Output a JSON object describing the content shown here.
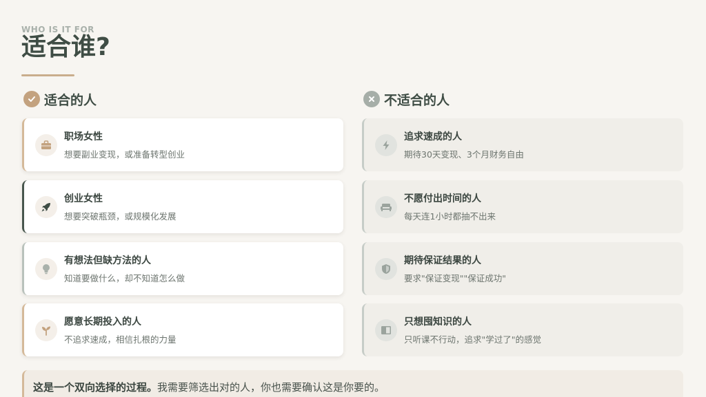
{
  "header": {
    "eyebrow": "WHO IS IT FOR",
    "title": "适合谁?"
  },
  "fit": {
    "heading": "适合的人",
    "items": [
      {
        "icon": "briefcase-icon",
        "title": "职场女性",
        "desc": "想要副业变现，或准备转型创业"
      },
      {
        "icon": "rocket-icon",
        "title": "创业女性",
        "desc": "想要突破瓶颈，或规模化发展"
      },
      {
        "icon": "lightbulb-icon",
        "title": "有想法但缺方法的人",
        "desc": "知道要做什么，却不知道怎么做"
      },
      {
        "icon": "seedling-icon",
        "title": "愿意长期投入的人",
        "desc": "不追求速成，相信扎根的力量"
      }
    ]
  },
  "unfit": {
    "heading": "不适合的人",
    "items": [
      {
        "icon": "bolt-icon",
        "title": "追求速成的人",
        "desc": "期待30天变现、3个月财务自由"
      },
      {
        "icon": "couch-icon",
        "title": "不愿付出时间的人",
        "desc": "每天连1小时都抽不出来"
      },
      {
        "icon": "shield-icon",
        "title": "期待保证结果的人",
        "desc": "要求\"保证变现\"\"保证成功\""
      },
      {
        "icon": "book-icon",
        "title": "只想囤知识的人",
        "desc": "只听课不行动，追求\"学过了\"的感觉"
      }
    ]
  },
  "note": {
    "bold": "这是一个双向选择的过程。",
    "text": "我需要筛选出对的人，你也需要确认这是你要的。"
  },
  "colors": {
    "accent": "#c3a27f",
    "dark": "#47564d",
    "muted": "#a6aea8"
  }
}
